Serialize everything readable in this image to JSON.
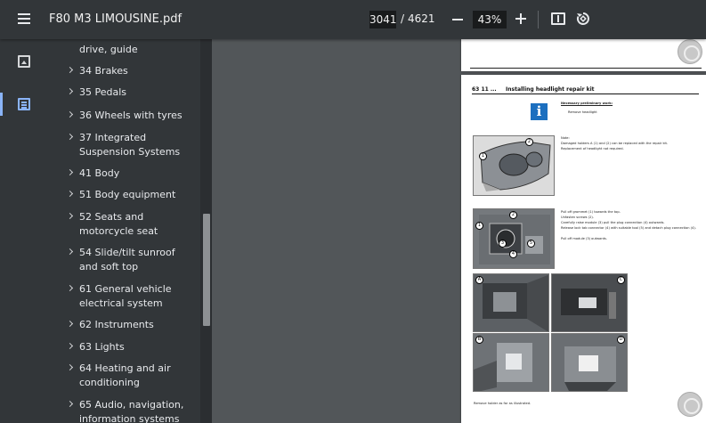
{
  "toolbar": {
    "title": "F80 M3 LIMOUSINE.pdf",
    "current_page": "3041",
    "page_separator": "/",
    "total_pages": "4621",
    "zoom": "43%"
  },
  "toc": {
    "items": [
      {
        "label": "drive, guide"
      },
      {
        "label": "34 Brakes"
      },
      {
        "label": "35 Pedals"
      },
      {
        "label": "36 Wheels with tyres"
      },
      {
        "label": "37 Integrated Suspension Systems"
      },
      {
        "label": "41 Body"
      },
      {
        "label": "51 Body equipment"
      },
      {
        "label": "52 Seats and motorcycle seat"
      },
      {
        "label": "54 Slide/tilt sunroof and soft top"
      },
      {
        "label": "61 General vehicle electrical system"
      },
      {
        "label": "62 Instruments"
      },
      {
        "label": "63 Lights"
      },
      {
        "label": "64 Heating and air conditioning"
      },
      {
        "label": "65 Audio, navigation, information systems"
      }
    ]
  },
  "doc": {
    "section_number": "63 11 ...",
    "section_title": "Installing headlight repair kit",
    "necessary_work_heading": "Necessary preliminary work:",
    "necessary_work_item": "Remove headlight",
    "note_1": "Note:",
    "note_2": "Damaged holders A (1) and (2) can be replaced with the repair kit.",
    "note_3": "Replacement of headlight not required.",
    "step_1": "Pull off grommet (1) towards the top.",
    "step_2": "Unfasten screws (2).",
    "step_3": "Carefully raise module (3) pull the plug connection (4) outwards.",
    "step_4": "Release lock tab connector (4) with suitable tool (5) and detach plug connection (4).",
    "step_5": "Pull off module (3) outwards.",
    "footer_note": "Remove holder as far as illustrated.",
    "photo_labels": [
      "1",
      "2",
      "1",
      "2",
      "3",
      "4",
      "5",
      "A",
      "B",
      "C",
      "D"
    ]
  }
}
